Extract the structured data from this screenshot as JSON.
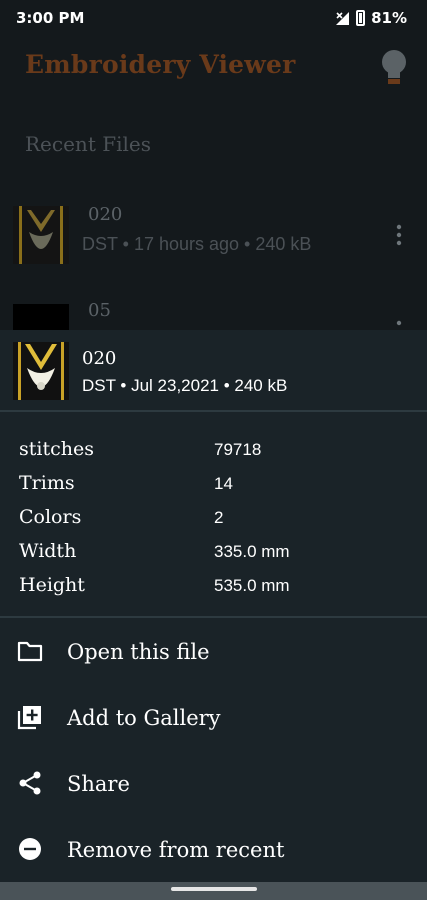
{
  "status_bar": {
    "time": "3:00 PM",
    "battery": "81%"
  },
  "app": {
    "title": "Embroidery Viewer",
    "recent_header": "Recent Files"
  },
  "recent_files": [
    {
      "name": "020",
      "meta": "DST • 17 hours ago • 240 kB"
    },
    {
      "name": "05"
    }
  ],
  "sheet": {
    "file_name": "020",
    "file_meta": "DST • Jul 23,2021 • 240 kB",
    "details": [
      {
        "label": "stitches",
        "value": "79718"
      },
      {
        "label": "Trims",
        "value": "14"
      },
      {
        "label": "Colors",
        "value": "2"
      },
      {
        "label": "Width",
        "value": "335.0 mm"
      },
      {
        "label": "Height",
        "value": "535.0 mm"
      }
    ],
    "actions": [
      {
        "label": "Open this file",
        "icon": "folder-icon"
      },
      {
        "label": "Add to Gallery",
        "icon": "add-library-icon"
      },
      {
        "label": "Share",
        "icon": "share-icon"
      },
      {
        "label": "Remove from recent",
        "icon": "remove-circle-icon"
      }
    ]
  },
  "colors": {
    "title": "#6a3a1a",
    "sheet_background": "#1a2328",
    "thumbnail_gold": "#c9a227"
  }
}
